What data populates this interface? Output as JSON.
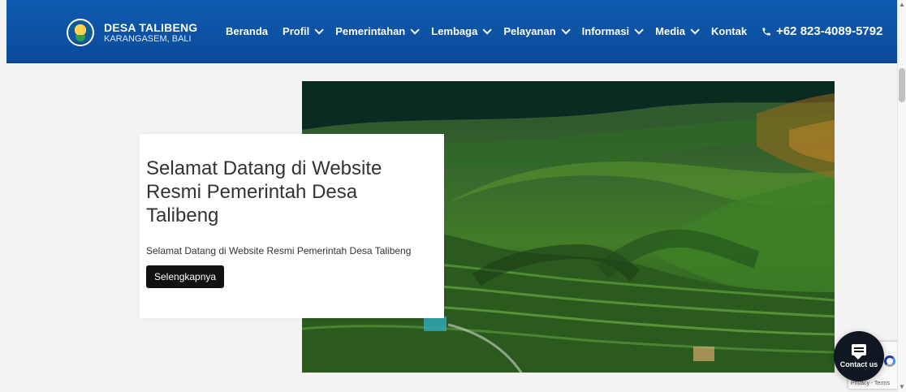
{
  "brand": {
    "name": "DESA TALIBENG",
    "subtitle": "KARANGASEM, BALI"
  },
  "nav": {
    "items": [
      {
        "label": "Beranda",
        "dropdown": false
      },
      {
        "label": "Profil",
        "dropdown": true
      },
      {
        "label": "Pemerintahan",
        "dropdown": true
      },
      {
        "label": "Lembaga",
        "dropdown": true
      },
      {
        "label": "Pelayanan",
        "dropdown": true
      },
      {
        "label": "Informasi",
        "dropdown": true
      },
      {
        "label": "Media",
        "dropdown": true
      },
      {
        "label": "Kontak",
        "dropdown": false
      }
    ],
    "phone": "+62 823-4089-5792"
  },
  "hero": {
    "title": "Selamat Datang di Website Resmi Pemerintah Desa Talibeng",
    "description": "Selamat Datang di Website Resmi Pemerintah Desa Talibeng",
    "button_label": "Selengkapnya"
  },
  "widgets": {
    "contact_label": "Contact us",
    "recaptcha_text": "Privacy - Terms"
  },
  "colors": {
    "header": "#0b4a99",
    "button": "#111111",
    "accent_text": "#333333"
  }
}
